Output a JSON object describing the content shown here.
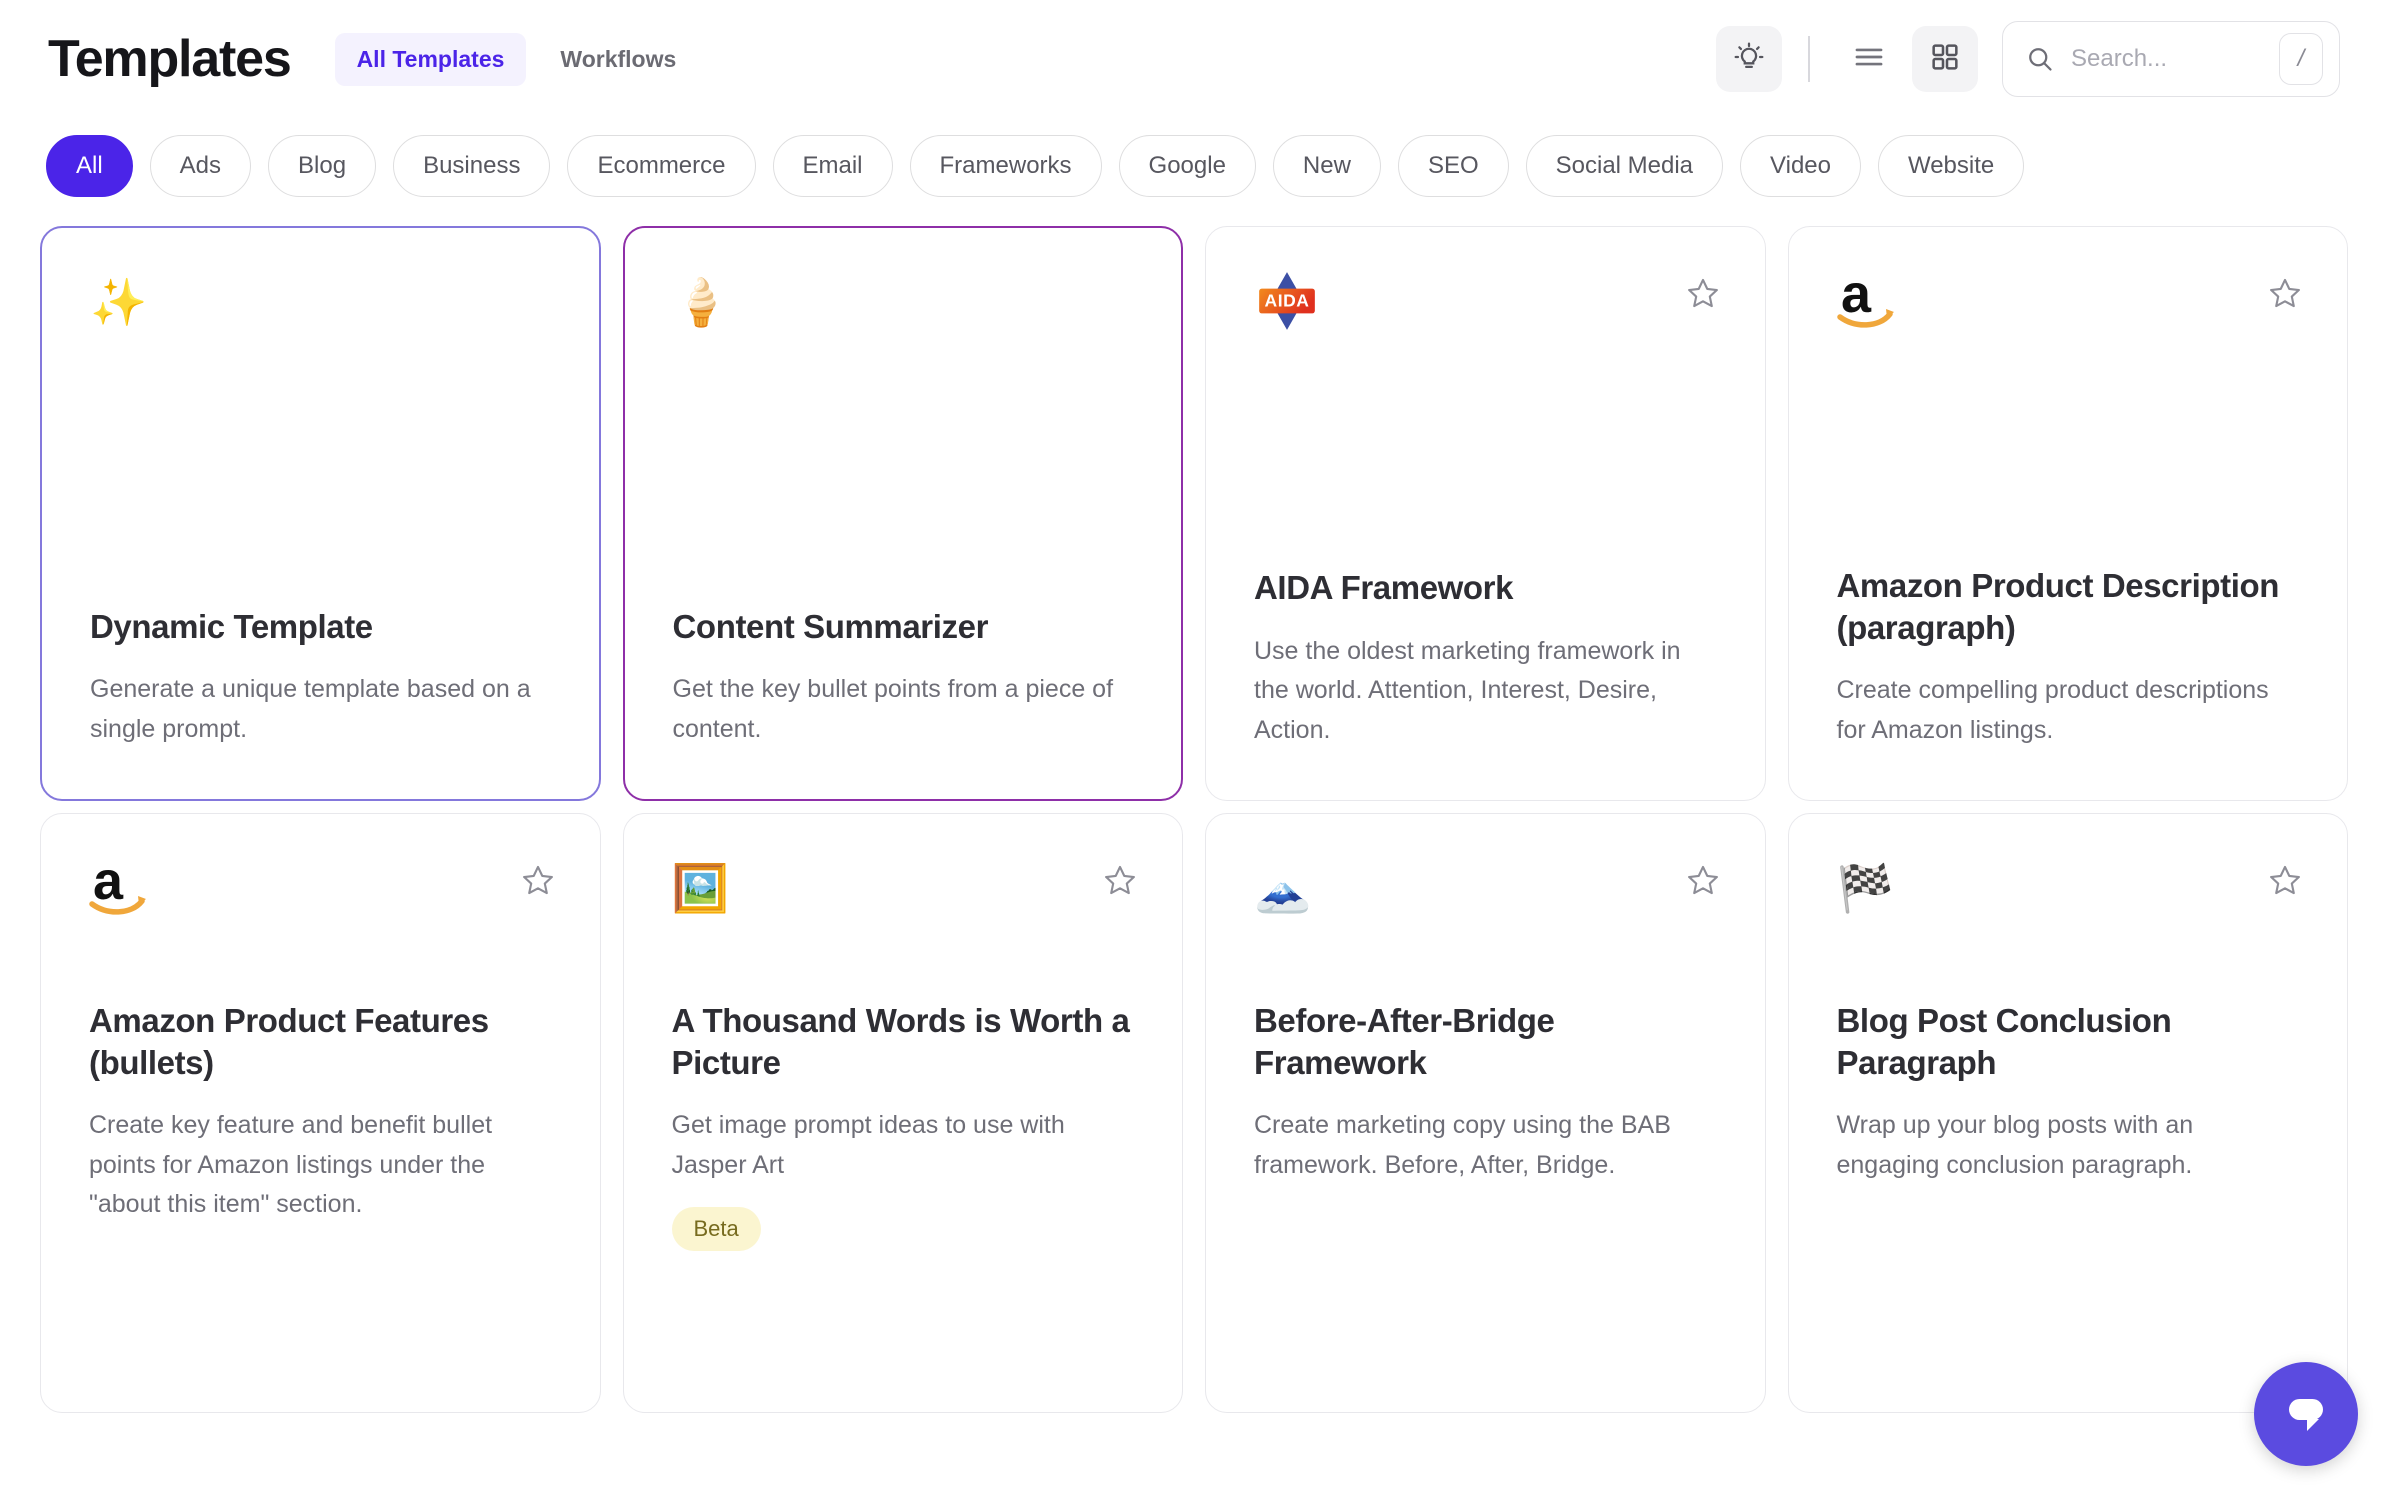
{
  "header": {
    "title": "Templates",
    "tabs": [
      {
        "label": "All Templates",
        "active": true
      },
      {
        "label": "Workflows",
        "active": false
      }
    ],
    "tools": {
      "lightbulb_icon": "lightbulb-icon",
      "list_view_icon": "list-view-icon",
      "grid_view_icon": "grid-view-icon"
    },
    "search": {
      "placeholder": "Search...",
      "value": "",
      "shortcut": "/",
      "icon": "search-icon"
    }
  },
  "filters": {
    "items": [
      {
        "label": "All",
        "active": true
      },
      {
        "label": "Ads",
        "active": false
      },
      {
        "label": "Blog",
        "active": false
      },
      {
        "label": "Business",
        "active": false
      },
      {
        "label": "Ecommerce",
        "active": false
      },
      {
        "label": "Email",
        "active": false
      },
      {
        "label": "Frameworks",
        "active": false
      },
      {
        "label": "Google",
        "active": false
      },
      {
        "label": "New",
        "active": false
      },
      {
        "label": "SEO",
        "active": false
      },
      {
        "label": "Social Media",
        "active": false
      },
      {
        "label": "Video",
        "active": false
      },
      {
        "label": "Website",
        "active": false
      }
    ]
  },
  "cards": {
    "row1": [
      {
        "title": "Dynamic Template",
        "desc": "Generate a unique template based on a single prompt.",
        "emoji": "✨",
        "emoji_name": "sparkles-icon",
        "accent": "indigo",
        "has_star": false,
        "badge": ""
      },
      {
        "title": "Content Summarizer",
        "desc": "Get the key bullet points from a piece of content.",
        "emoji": "🍦",
        "emoji_name": "soft-ice-cream-icon",
        "accent": "purple",
        "has_star": false,
        "badge": ""
      },
      {
        "title": "AIDA Framework",
        "desc": "Use the oldest marketing framework in the world. Attention, Interest, Desire, Action.",
        "emoji": "",
        "emoji_name": "aida-logo-icon",
        "accent": "none",
        "has_star": true,
        "badge": ""
      },
      {
        "title": "Amazon Product Description (paragraph)",
        "desc": "Create compelling product descriptions for Amazon listings.",
        "emoji": "",
        "emoji_name": "amazon-logo-icon",
        "accent": "none",
        "has_star": true,
        "badge": ""
      }
    ],
    "row2": [
      {
        "title": "Amazon Product Features (bullets)",
        "desc": "Create key feature and benefit bullet points for Amazon listings under the \"about this item\" section.",
        "emoji": "",
        "emoji_name": "amazon-logo-icon",
        "accent": "none",
        "has_star": true,
        "badge": ""
      },
      {
        "title": "A Thousand Words is Worth a Picture",
        "desc": "Get image prompt ideas to use with Jasper Art",
        "emoji": "🖼️",
        "emoji_name": "framed-picture-icon",
        "accent": "none",
        "has_star": true,
        "badge": "Beta"
      },
      {
        "title": "Before-After-Bridge Framework",
        "desc": "Create marketing copy using the BAB framework. Before, After, Bridge.",
        "emoji": "🗻",
        "emoji_name": "mount-fuji-icon",
        "accent": "none",
        "has_star": true,
        "badge": ""
      },
      {
        "title": "Blog Post Conclusion Paragraph",
        "desc": "Wrap up your blog posts with an engaging conclusion paragraph.",
        "emoji": "🏁",
        "emoji_name": "chequered-flag-icon",
        "accent": "none",
        "has_star": true,
        "badge": ""
      }
    ]
  },
  "chat_widget": {
    "icon": "chat-bubble-icon",
    "color": "#5B4BE0"
  },
  "colors": {
    "accent_primary": "#4B24E8",
    "accent_card_indigo": "#8478DC",
    "accent_card_purple": "#8E2FA8",
    "badge_bg": "#FBF5D0",
    "badge_text": "#776B1F",
    "text_primary": "#2E2E34",
    "text_secondary": "#6E6E77",
    "border": "#E8E8EC"
  }
}
